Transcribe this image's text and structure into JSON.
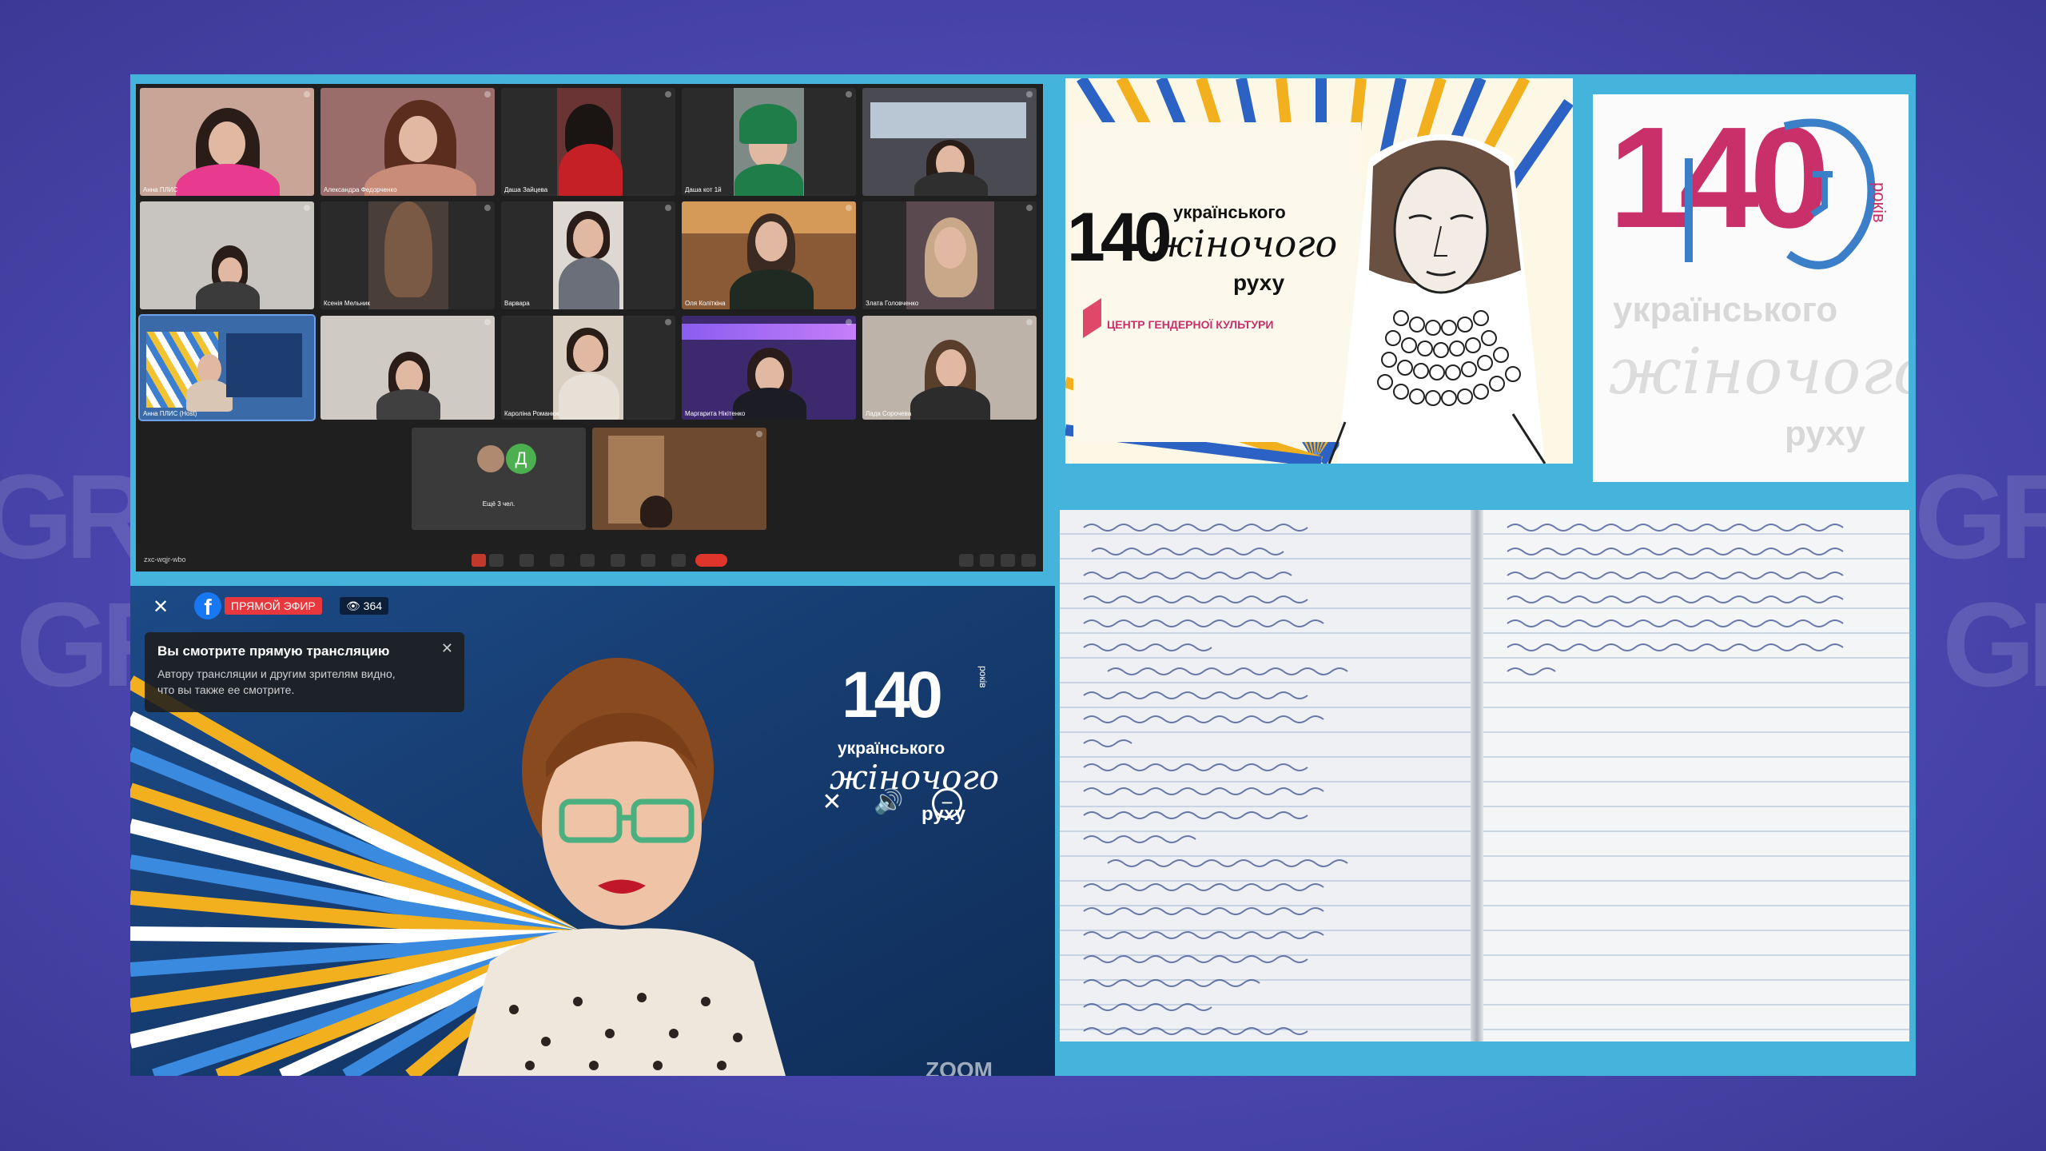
{
  "zoom": {
    "participants": [
      {
        "name": "Анна ПЛИС"
      },
      {
        "name": "Александра Федорченко"
      },
      {
        "name": "Даша Зайцева"
      },
      {
        "name": "Даша кот 1й"
      },
      {
        "name": ""
      },
      {
        "name": ""
      },
      {
        "name": "Ксенія Мельник"
      },
      {
        "name": "Варвара"
      },
      {
        "name": "Оля Коліткіна"
      },
      {
        "name": "Злата Головченко"
      },
      {
        "name": "Анна ПЛИС (Host)"
      },
      {
        "name": ""
      },
      {
        "name": "Кароліна Романюк"
      },
      {
        "name": "Маргарита Нікітенко"
      },
      {
        "name": "Лада Сорочева"
      }
    ],
    "others_avatar_letter": "Д",
    "others_label": "Ещё 3 чел.",
    "meeting_id": "zxc-wqjr-wbo"
  },
  "poster": {
    "number": "140",
    "line1": "українського",
    "line2": "жіночого",
    "line3": "руху",
    "org": "ЦЕНТР ГЕНДЕРНОЇ КУЛЬТУРИ"
  },
  "logo": {
    "number": "140",
    "years": "років",
    "line1": "українського",
    "line2": "жіночого",
    "line3": "руху"
  },
  "stream": {
    "platform_icon": "facebook-icon",
    "live_label": "ПРЯМОЙ ЭФИР",
    "viewer_count": "364",
    "toast_title": "Вы смотрите прямую трансляцию",
    "toast_body": "Автору трансляции и другим зрителям видно, что вы также ее смотрите.",
    "overlay_number": "140",
    "overlay_years": "років",
    "overlay_line1": "українського",
    "overlay_line2": "жіночого",
    "overlay_line3": "руху",
    "footer_text": "ZOOM"
  },
  "colors": {
    "background": "#4b47b0",
    "collage_frame": "#45b4dc",
    "zoom_bg": "#1f1f1f",
    "stream_bg": "#14386a",
    "live_red": "#e8373d",
    "facebook_blue": "#1877f2",
    "logo_pink": "#c9306a",
    "logo_blue": "#3a7fc8"
  }
}
